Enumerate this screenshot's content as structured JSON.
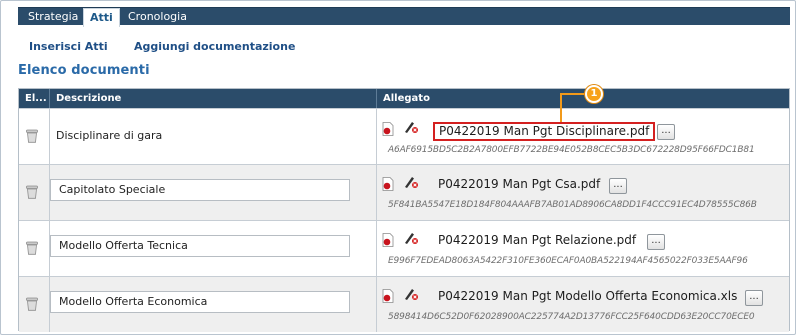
{
  "tabs": [
    {
      "label": "Strategia",
      "active": false
    },
    {
      "label": "Atti",
      "active": true
    },
    {
      "label": "Cronologia",
      "active": false
    }
  ],
  "subnav": {
    "insert": "Inserisci Atti",
    "add_docs": "Aggiungi documentazione"
  },
  "section_title": "Elenco documenti",
  "table": {
    "headers": {
      "el": "El...",
      "descrizione": "Descrizione",
      "allegato": "Allegato"
    },
    "rows": [
      {
        "description": "Disciplinare di gara",
        "file": "P0422019 Man Pgt Disciplinare.pdf",
        "hash": "A6AF6915BD5C2B2A7800EFB7722BE94E052B8CEC5B3DC672228D95F66FDC1B81",
        "browse": "..."
      },
      {
        "description": "Capitolato Speciale",
        "file": "P0422019 Man Pgt Csa.pdf",
        "hash": "5F841BA5547E18D184F804AAAFB7AB01AD8906CA8DD1F4CCC91EC4D78555C86B",
        "browse": "..."
      },
      {
        "description": "Modello Offerta Tecnica",
        "file": "P0422019 Man Pgt Relazione.pdf",
        "hash": "E996F7EDEAD8063A5422F310FE360ECAF0A0BA522194AF4565022F033E5AAF96",
        "browse": "..."
      },
      {
        "description": "Modello Offerta Economica",
        "file": "P0422019 Man Pgt Modello Offerta Economica.xls",
        "hash": "5898414D6C52D0F62028900AC225774A2D13776FCC25F640CDD63E20CC70ECE0",
        "browse": "..."
      }
    ]
  },
  "callout": {
    "number": "1"
  },
  "colors": {
    "header_bg": "#2b4c6a",
    "link": "#1f4f86",
    "title": "#2a6aa8",
    "callout": "#f7a21b",
    "highlight_border": "#d42020"
  }
}
